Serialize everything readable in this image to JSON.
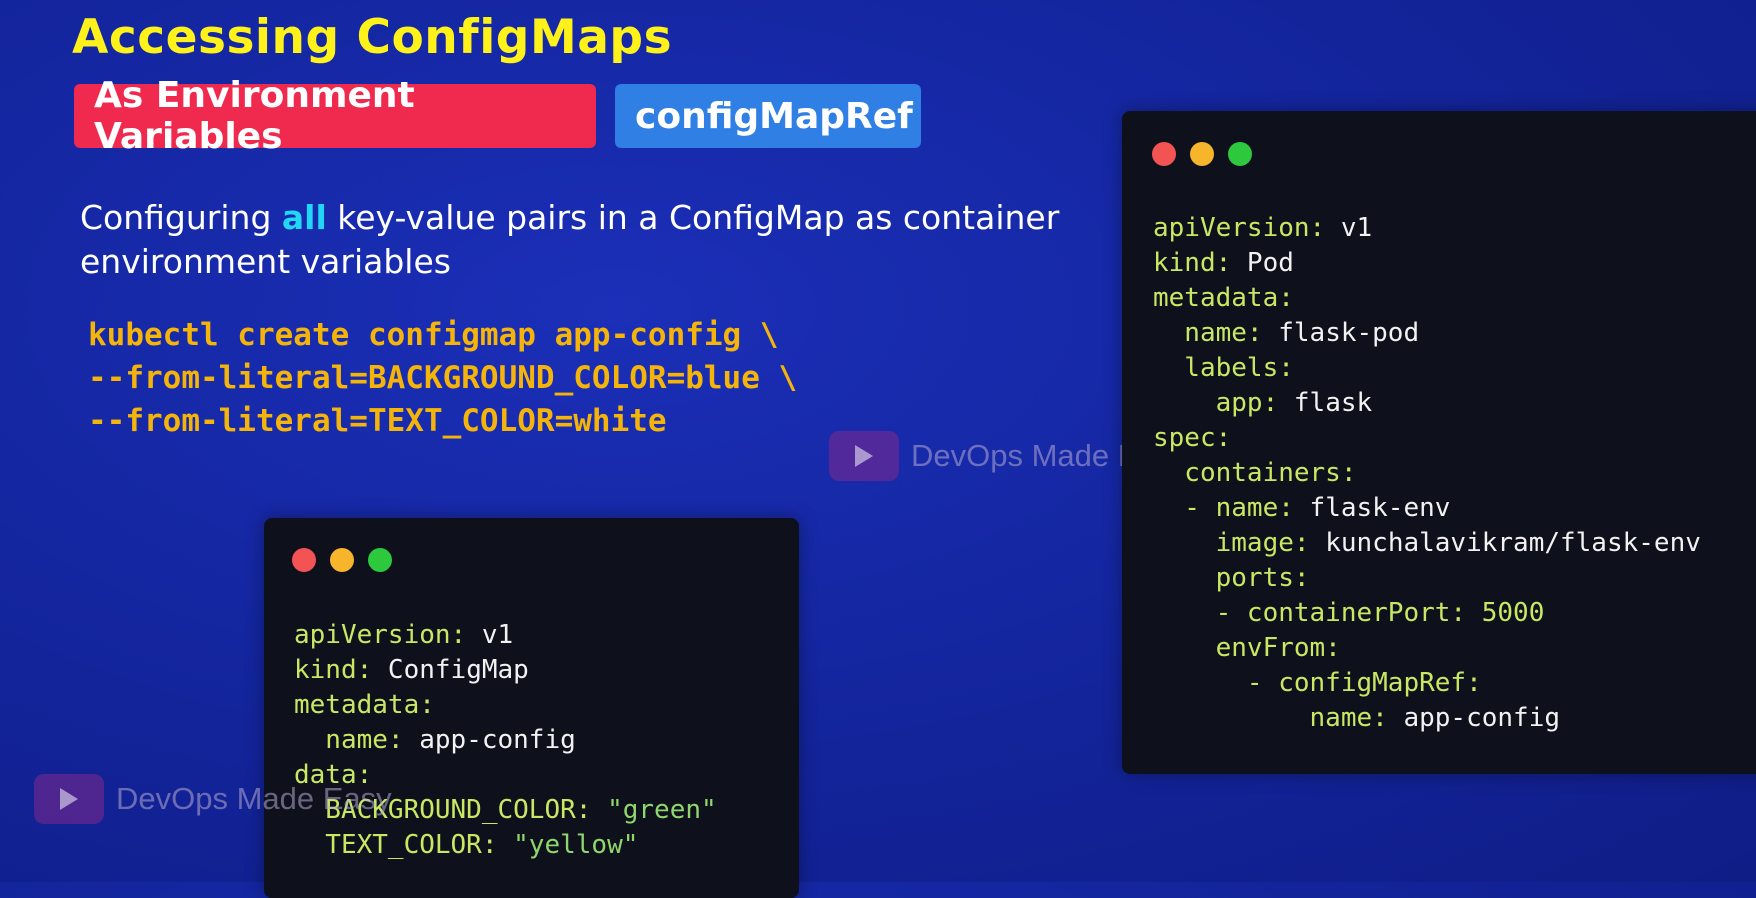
{
  "title": "Accessing ConfigMaps",
  "tags": {
    "env_vars": "As Environment Variables",
    "config_map_ref": "configMapRef"
  },
  "description": {
    "before": "Configuring ",
    "highlight": "all",
    "after": " key-value pairs in a ConfigMap as container environment variables"
  },
  "command": {
    "line1": "kubectl create configmap app-config \\",
    "line2": "--from-literal=BACKGROUND_COLOR=blue \\",
    "line3": "--from-literal=TEXT_COLOR=white"
  },
  "configmap_yaml": {
    "api_key": "apiVersion:",
    "api_val": " v1",
    "kind_key": "kind:",
    "kind_val": " ConfigMap",
    "meta_key": "metadata:",
    "name_key": "  name:",
    "name_val": " app-config",
    "data_key": "data:",
    "bg_key": "  BACKGROUND_COLOR:",
    "bg_val": " \"green\"",
    "text_key": "  TEXT_COLOR:",
    "text_val": " \"yellow\""
  },
  "pod_yaml": {
    "api_key": "apiVersion:",
    "api_val": " v1",
    "kind_key": "kind:",
    "kind_val": " Pod",
    "meta_key": "metadata:",
    "name_key": "  name:",
    "name_val": " flask-pod",
    "labels_key": "  labels:",
    "app_key": "    app:",
    "app_val": " flask",
    "spec_key": "spec:",
    "containers_key": "  containers:",
    "cname_key": "  - name:",
    "cname_val": " flask-env",
    "image_key": "    image:",
    "image_val": " kunchalavikram/flask-env",
    "ports_key": "    ports:",
    "port_key": "    - containerPort:",
    "port_val": " 5000",
    "envfrom_key": "    envFrom:",
    "cmref_key": "      - configMapRef:",
    "refname_key": "          name:",
    "refname_val": " app-config"
  },
  "watermark": "DevOps Made Easy",
  "colors": {
    "title": "#fff21a",
    "tag_red": "#f0294f",
    "tag_blue": "#2f7fe4",
    "highlight": "#22d6f5",
    "command": "#f5b40a",
    "yaml_key": "#c8e864"
  }
}
